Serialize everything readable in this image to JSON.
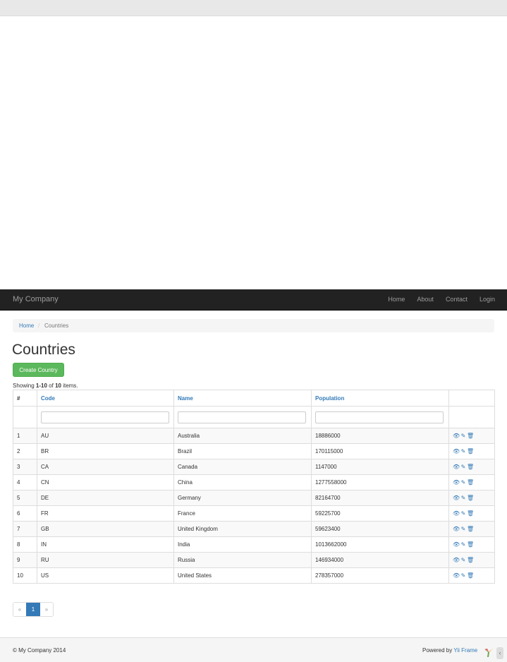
{
  "navbar": {
    "brand": "My Company",
    "links": [
      "Home",
      "About",
      "Contact",
      "Login"
    ]
  },
  "breadcrumb": {
    "home": "Home",
    "separator": "/",
    "current": "Countries"
  },
  "page_title": "Countries",
  "create_button": "Create Country",
  "summary": {
    "prefix": "Showing ",
    "range": "1-10",
    "of": " of ",
    "total": "10",
    "suffix": " items."
  },
  "table": {
    "headers": [
      "#",
      "Code",
      "Name",
      "Population"
    ],
    "rows": [
      {
        "n": "1",
        "code": "AU",
        "name": "Australia",
        "population": "18886000"
      },
      {
        "n": "2",
        "code": "BR",
        "name": "Brazil",
        "population": "170115000"
      },
      {
        "n": "3",
        "code": "CA",
        "name": "Canada",
        "population": "1147000"
      },
      {
        "n": "4",
        "code": "CN",
        "name": "China",
        "population": "1277558000"
      },
      {
        "n": "5",
        "code": "DE",
        "name": "Germany",
        "population": "82164700"
      },
      {
        "n": "6",
        "code": "FR",
        "name": "France",
        "population": "59225700"
      },
      {
        "n": "7",
        "code": "GB",
        "name": "United Kingdom",
        "population": "59623400"
      },
      {
        "n": "8",
        "code": "IN",
        "name": "India",
        "population": "1013662000"
      },
      {
        "n": "9",
        "code": "RU",
        "name": "Russia",
        "population": "146934000"
      },
      {
        "n": "10",
        "code": "US",
        "name": "United States",
        "population": "278357000"
      }
    ],
    "action_icons": [
      "eye-icon",
      "pencil-icon",
      "trash-icon"
    ]
  },
  "pagination": {
    "prev": "«",
    "current": "1",
    "next": "»"
  },
  "footer": {
    "copyright": "© My Company 2014",
    "powered_prefix": "Powered by ",
    "powered_link": "Yii Frame"
  },
  "colors": {
    "navbar_bg": "#222222",
    "link": "#337ab7",
    "success": "#5cb85c",
    "footer_bg": "#f5f5f5"
  }
}
